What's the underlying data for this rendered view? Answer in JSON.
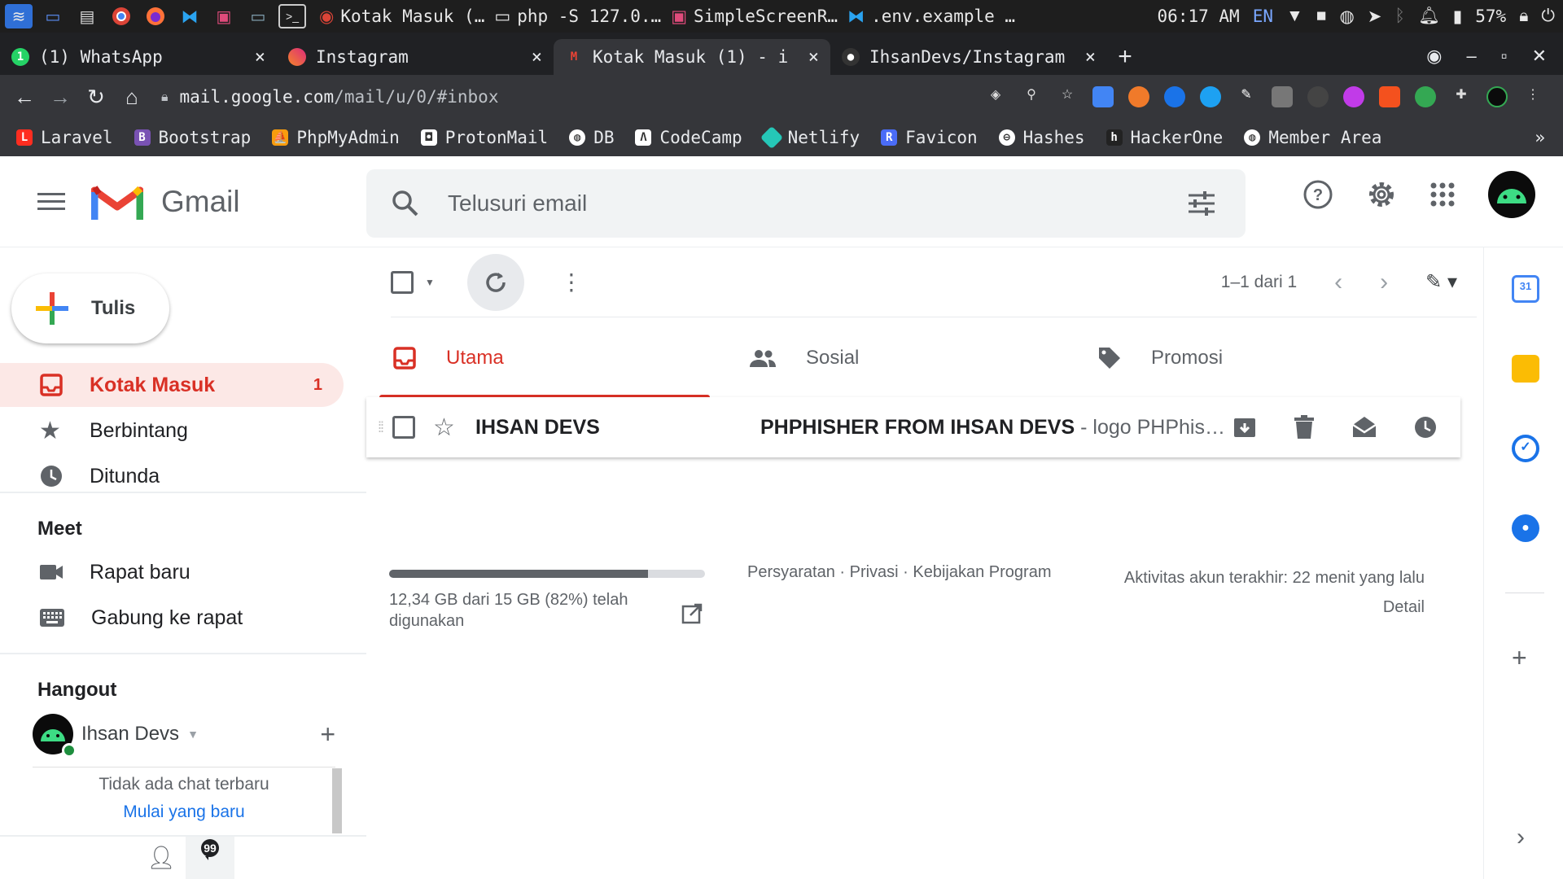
{
  "os_taskbar": {
    "tasks": [
      {
        "label": "Kotak Masuk (…",
        "icon": "chrome-icon"
      },
      {
        "label": "php -S 127.0.…",
        "icon": "terminal-icon"
      },
      {
        "label": "SimpleScreenR…",
        "icon": "recorder-icon"
      },
      {
        "label": ".env.example …",
        "icon": "vscode-icon"
      }
    ],
    "time": "06:17 AM",
    "lang": "EN",
    "battery": "57%"
  },
  "browser": {
    "tabs": [
      {
        "title": "(1) WhatsApp",
        "active": false
      },
      {
        "title": "Instagram",
        "active": false
      },
      {
        "title": "Kotak Masuk (1) - i",
        "active": true
      },
      {
        "title": "IhsanDevs/Instagram",
        "active": false
      }
    ],
    "url_host": "mail.google.com",
    "url_path": "/mail/u/0/#inbox",
    "bookmarks": [
      "Laravel",
      "Bootstrap",
      "PhpMyAdmin",
      "ProtonMail",
      "DB",
      "CodeCamp",
      "Netlify",
      "Favicon",
      "Hashes",
      "HackerOne",
      "Member Area"
    ],
    "bookmark_colors": [
      "#ff2d20",
      "#7952b3",
      "#f89c0e",
      "#ffffff",
      "#ffffff",
      "#ffffff",
      "#25c7b7",
      "#4a6cf7",
      "#ffffff",
      "#ffffff",
      "#ffffff"
    ]
  },
  "gmail": {
    "brand": "Gmail",
    "search_placeholder": "Telusuri email",
    "compose_label": "Tulis",
    "nav": [
      {
        "label": "Kotak Masuk",
        "count": "1",
        "icon": "inbox-icon"
      },
      {
        "label": "Berbintang",
        "icon": "star-icon"
      },
      {
        "label": "Ditunda",
        "icon": "clock-icon"
      }
    ],
    "meet": {
      "title": "Meet",
      "items": [
        {
          "label": "Rapat baru",
          "icon": "video-icon"
        },
        {
          "label": "Gabung ke rapat",
          "icon": "keyboard-icon"
        }
      ]
    },
    "hangout": {
      "title": "Hangout",
      "user": "Ihsan Devs",
      "empty_text": "Tidak ada chat terbaru",
      "start_link": "Mulai yang baru"
    },
    "pagination": "1–1 dari 1",
    "categories": [
      {
        "label": "Utama",
        "icon": "inbox-icon"
      },
      {
        "label": "Sosial",
        "icon": "people-icon"
      },
      {
        "label": "Promosi",
        "icon": "tag-icon"
      }
    ],
    "emails": [
      {
        "sender": "IHSAN DEVS",
        "subject": "PHPHISHER FROM IHSAN DEVS",
        "snippet": " - logo PHPhis…"
      }
    ],
    "storage": {
      "text": "12,34 GB dari 15 GB (82%) telah digunakan",
      "fraction": 0.82
    },
    "footer_links": "Persyaratan · Privasi · Kebijakan Program",
    "last_activity": "Aktivitas akun terakhir: 22 menit yang lalu",
    "detail_link": "Detail",
    "colors": {
      "accent_red": "#d93025",
      "active_bg": "#fce8e6"
    }
  }
}
